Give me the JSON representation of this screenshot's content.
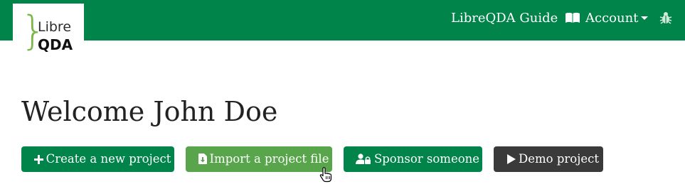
{
  "brand": {
    "logo_line1": "Libre",
    "logo_line2": "QDA",
    "brace": "}"
  },
  "navbar": {
    "guide_label": "LibreQDA Guide",
    "account_label": "Account",
    "guide_icon": "book-open-icon",
    "bug_icon": "bug-icon"
  },
  "main": {
    "welcome": "Welcome John Doe"
  },
  "actions": {
    "create_label": "Create a new project",
    "import_label": "Import a project file",
    "sponsor_label": "Sponsor someone",
    "demo_label": "Demo project"
  },
  "colors": {
    "primary": "#00844a",
    "import_hover": "#58a54c",
    "dark": "#3a3a3a",
    "logo_accent": "#7ab648"
  }
}
